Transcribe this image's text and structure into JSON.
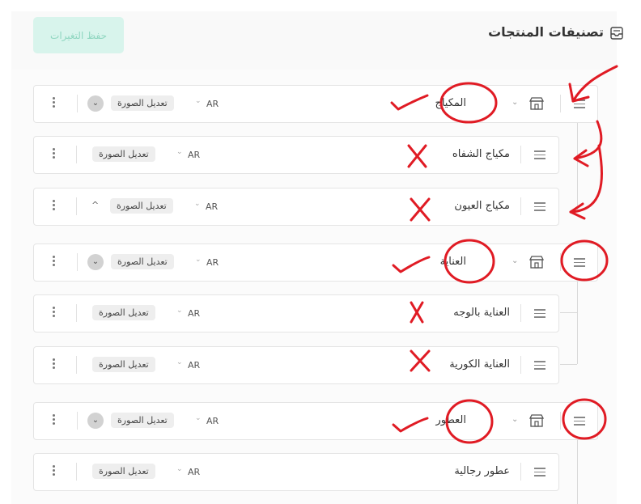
{
  "header": {
    "title": "تصنيفات المنتجات",
    "save_label": "حفظ التغيرات"
  },
  "common": {
    "lang": "AR",
    "edit_image": "تعديل الصورة"
  },
  "rows": [
    {
      "label": "المكياج"
    },
    {
      "label": "مكياج الشفاه"
    },
    {
      "label": "مكياج العيون"
    },
    {
      "label": "العناية"
    },
    {
      "label": "العناية بالوجه"
    },
    {
      "label": "العناية الكورية"
    },
    {
      "label": "العطور"
    },
    {
      "label": "عطور رجالية"
    }
  ],
  "colors": {
    "accent_bg": "#d8f4ec",
    "accent_text": "#8fd6c0",
    "annotation": "#e01b24"
  }
}
